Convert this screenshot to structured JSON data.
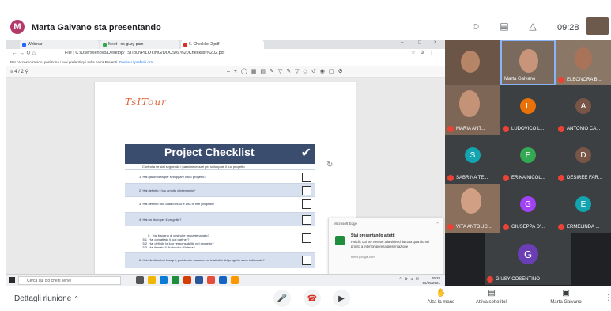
{
  "header": {
    "presenter_initial": "M",
    "title": "Marta Galvano sta presentando",
    "time": "09:28",
    "icons": [
      "people-icon",
      "chat-icon",
      "activities-icon"
    ]
  },
  "browser": {
    "tabs": [
      {
        "label": "Webinar",
        "active": false
      },
      {
        "label": "Meet - ns-guzy-pam",
        "active": false
      },
      {
        "label": "6. Checklist 2.pdf",
        "active": true
      }
    ],
    "address": "File  |  C:/Users/lenovo/Desktop/TSITour/PILOTING/DOCS/6.%20Checklist%202.pdf",
    "favorites_text": "Per l'accesso rapido, posiziona i tuoi preferiti qui sulla barra Preferiti.",
    "favorites_link": "Gestisci i preferiti ora",
    "pdf_page": "4 / 2"
  },
  "document": {
    "logo": "TsITour",
    "checklist_title": "Project Checklist",
    "checklist_subtitle": "Controlla se stai seguendo i passi necessari per sviluppare il tuo progetto",
    "rows": [
      "1.  Hai già un'idea per sviluppare il tuo progetto?",
      "2.  Hai definito il tuo ambito d'intervento?",
      "3.  Hai definito una data d'inizio e una di fine progetto?",
      "4.  Hai un titolo per il progetto?",
      "5.  Hai bisogno di costruire un partenariato?\n    5.1  Hai contattato il tuoi partner?\n    5.2  Hai definito le loro responsabilità nel progetto?\n    5.3  Hai firmato il Protocollo d'Intesa?",
      "6.  Hai identificato i bisogni, problemi e cause a cui le attività del progetto sono indirizzate?"
    ]
  },
  "notification": {
    "app": "Microsoft Edge",
    "title": "Stai presentando a tutti",
    "body": "Fai clic qui per tornare alla videochiamata quando sei pronto a interrompere la presentazione",
    "url": "meet.google.com"
  },
  "taskbar": {
    "search_placeholder": "Cerca qui ciò che ti serve",
    "time": "09:28",
    "date": "06/05/2021"
  },
  "participants": [
    {
      "name": "",
      "type": "video",
      "initial": ""
    },
    {
      "name": "Marta Galvano",
      "type": "video",
      "initial": ""
    },
    {
      "name": "ELEONORA B...",
      "type": "video",
      "initial": ""
    },
    {
      "name": "MARIA ANT...",
      "type": "video",
      "initial": ""
    },
    {
      "name": "LUDOVICO L...",
      "type": "avatar",
      "initial": "L",
      "color": "#e8710a"
    },
    {
      "name": "ANTONIO CA...",
      "type": "avatar",
      "initial": "A",
      "color": "#795548"
    },
    {
      "name": "SABRINA TE...",
      "type": "avatar",
      "initial": "S",
      "color": "#12a4af"
    },
    {
      "name": "ERIKA NICOL...",
      "type": "avatar",
      "initial": "E",
      "color": "#34a853"
    },
    {
      "name": "DESIREE FAR...",
      "type": "avatar",
      "initial": "D",
      "color": "#795548"
    },
    {
      "name": "VITA ANTOLIC...",
      "type": "video",
      "initial": ""
    },
    {
      "name": "GIUSEPPA D'...",
      "type": "avatar",
      "initial": "G",
      "color": "#a142f4"
    },
    {
      "name": "ERMELINDA ...",
      "type": "avatar",
      "initial": "E",
      "color": "#12a4af"
    },
    {
      "name": "GIUSY COSENTINO",
      "type": "avatar",
      "initial": "G",
      "color": "#6a3fb5"
    }
  ],
  "bottom": {
    "meeting_details": "Dettagli riunione",
    "raise_hand": "Alza la mano",
    "subtitles": "Attiva sottotitoli",
    "presenting": "Marta Galvano"
  }
}
